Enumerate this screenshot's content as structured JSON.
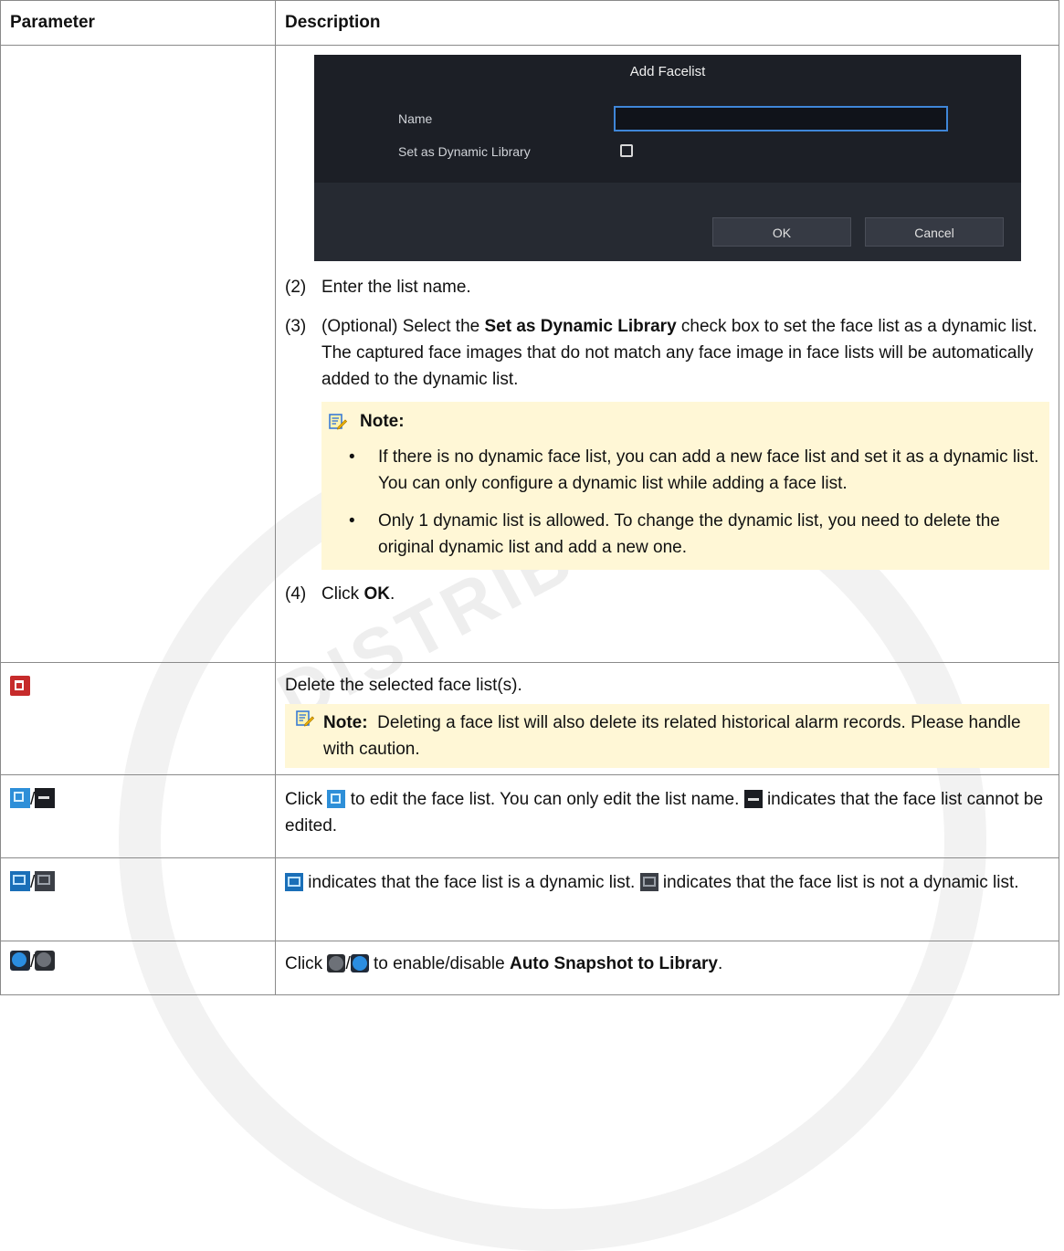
{
  "table": {
    "header_param": "Parameter",
    "header_desc": "Description"
  },
  "dialog": {
    "title": "Add Facelist",
    "name_label": "Name",
    "dynamic_label": "Set as Dynamic Library",
    "ok": "OK",
    "cancel": "Cancel"
  },
  "row1": {
    "step2_num": "(2)",
    "step2_text": "Enter the list name.",
    "step3_num": "(3)",
    "step3_pre": "(Optional) Select the ",
    "step3_bold": "Set as Dynamic Library",
    "step3_post": " check box to set the face list as a dynamic list. The captured face images that do not match any face image in face lists will be automatically added to the dynamic list.",
    "note_label": "Note:",
    "bullet1": "If there is no dynamic face list, you can add a new face list and set it as a dynamic list. You can only configure a dynamic list while adding a face list.",
    "bullet2": "Only 1 dynamic list is allowed. To change the dynamic list, you need to delete the original dynamic list and add a new one.",
    "step4_num": "(4)",
    "step4_pre": "Click ",
    "step4_bold": "OK",
    "step4_post": "."
  },
  "row2": {
    "icon": "delete-icon",
    "text": "Delete the selected face list(s).",
    "note_label": "Note:",
    "note_text": "Deleting a face list will also delete its related historical alarm records. Please handle with caution."
  },
  "row3": {
    "sep": "/",
    "text_a": "Click ",
    "text_b": " to edit the face list. You can only edit the list name. ",
    "text_c": " indicates that the face list cannot be edited."
  },
  "row4": {
    "sep": "/",
    "text_a": " indicates that the face list is a dynamic list. ",
    "text_b": " indicates that the face list is not a dynamic list."
  },
  "row5": {
    "sep": "/",
    "text_a": "Click ",
    "text_b": " to enable/disable ",
    "text_bold": "Auto Snapshot to Library",
    "text_c": "."
  },
  "watermark": "DISTRIBUTION",
  "colors": {
    "note_bg": "#fff7d6",
    "dialog_bg": "#1c1f26",
    "accent": "#2e8fd8",
    "delete": "#c62b2b"
  }
}
